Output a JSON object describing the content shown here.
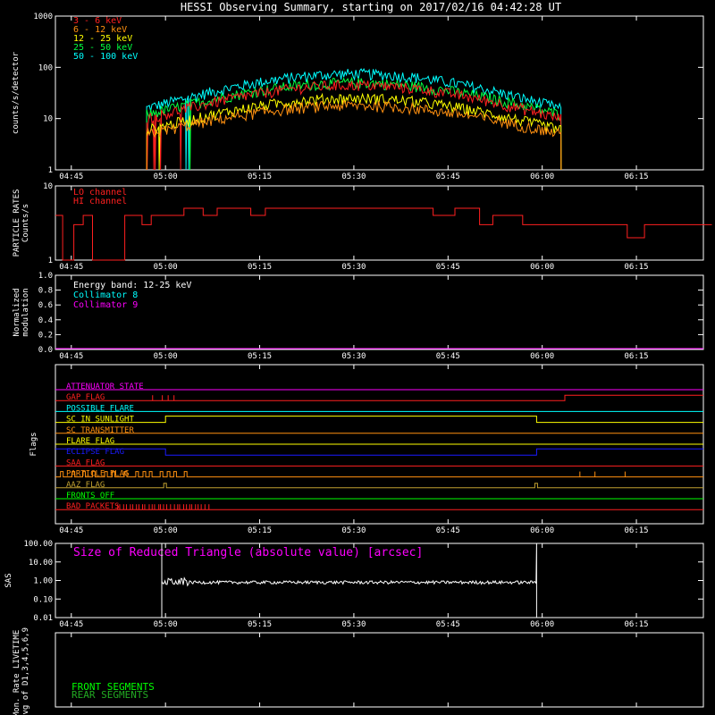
{
  "title": "HESSI Observing Summary, starting on 2017/02/16 04:42:28 UT",
  "time_ticks": [
    "04:45",
    "05:00",
    "05:15",
    "05:30",
    "05:45",
    "06:00",
    "06:15"
  ],
  "time_range_hours": [
    4.7078,
    6.4278
  ],
  "tick_hours": [
    4.75,
    5.0,
    5.25,
    5.5,
    5.75,
    6.0,
    6.25
  ],
  "colors": {
    "red": "#ff2020",
    "orange": "#ff9010",
    "yellow": "#ffff00",
    "green": "#00ff40",
    "cyan": "#00ffff",
    "magenta": "#ff00ff",
    "blue": "#1a1aff",
    "white": "#ffffff",
    "olive": "#c0a030",
    "lime": "#00ff00",
    "darkgreen": "#22aa22"
  },
  "chart_data": [
    {
      "type": "line",
      "panel": "count_rates",
      "ylabel": "counts/s/detector",
      "yscale": "log",
      "ylim": [
        1,
        1000
      ],
      "ytick_labels": [
        "1",
        "10",
        "100",
        "1000"
      ],
      "ytick_values": [
        1,
        10,
        100,
        1000
      ],
      "x_start_hours": 4.95,
      "x_end_hours": 6.05,
      "series": [
        {
          "name": "3 - 6 keV",
          "color": "#ff2020",
          "start": 10,
          "peak": 45
        },
        {
          "name": "6 - 12 keV",
          "color": "#ff9010",
          "start": 5,
          "peak": 18
        },
        {
          "name": "12 - 25 keV",
          "color": "#ffff00",
          "start": 6,
          "peak": 25
        },
        {
          "name": "25 - 50 keV",
          "color": "#00ff40",
          "start": 12,
          "peak": 50
        },
        {
          "name": "50 - 100 keV",
          "color": "#00ffff",
          "start": 16,
          "peak": 75
        }
      ]
    },
    {
      "type": "line",
      "panel": "particle_rates",
      "ylabel": "PARTICLE RATES\nCounts/s",
      "yscale": "log",
      "ylim": [
        1,
        10
      ],
      "ytick_labels": [
        "1",
        "10"
      ],
      "ytick_values": [
        1,
        10
      ],
      "series": [
        {
          "name": "LO channel",
          "color": "#ff2020"
        },
        {
          "name": "HI channel",
          "color": "#ff2020"
        }
      ]
    },
    {
      "type": "line",
      "panel": "modulation",
      "ylabel": "Normalized\nmodulation",
      "ylim": [
        0,
        1
      ],
      "ytick_labels": [
        "0.0",
        "0.2",
        "0.4",
        "0.6",
        "0.8",
        "1.0"
      ],
      "ytick_values": [
        0,
        0.2,
        0.4,
        0.6,
        0.8,
        1.0
      ],
      "annotation": "Energy band: 12-25 keV",
      "series": [
        {
          "name": "Collimator 8",
          "color": "#00ffff"
        },
        {
          "name": "Collimator 9",
          "color": "#ff00ff"
        }
      ]
    },
    {
      "type": "line",
      "panel": "flags",
      "ylabel": "Flags",
      "flags": [
        {
          "name": "ATTENUATOR STATE",
          "color": "#ff00ff"
        },
        {
          "name": "GAP FLAG",
          "color": "#ff2020"
        },
        {
          "name": "POSSIBLE FLARE",
          "color": "#00ffff"
        },
        {
          "name": "SC IN SUNLIGHT",
          "color": "#ffff00"
        },
        {
          "name": "SC TRANSMITTER",
          "color": "#ff9010"
        },
        {
          "name": "FLARE FLAG",
          "color": "#ffff00"
        },
        {
          "name": "ECLIPSE FLAG",
          "color": "#1a1aff"
        },
        {
          "name": "SAA FLAG",
          "color": "#ff2020"
        },
        {
          "name": "PARTICLE FLAG",
          "color": "#ff9010"
        },
        {
          "name": "AAZ FLAG",
          "color": "#c0a030"
        },
        {
          "name": "FRONTS OFF",
          "color": "#00ff00"
        },
        {
          "name": "BAD PACKETS",
          "color": "#ff2020"
        }
      ]
    },
    {
      "type": "line",
      "panel": "sas",
      "ylabel": "SAS",
      "yscale": "log",
      "ylim": [
        0.01,
        100
      ],
      "ytick_labels": [
        "0.01",
        "0.10",
        "1.00",
        "10.00",
        "100.00"
      ],
      "ytick_values": [
        0.01,
        0.1,
        1,
        10,
        100
      ],
      "annotation": "Size of Reduced Triangle (absolute value) [arcsec]",
      "series": [
        {
          "name": "Size of Reduced Triangle",
          "color": "#ffffff",
          "level": 0.8,
          "spike_start_hours": 4.99,
          "spike_end_hours": 5.985
        }
      ]
    },
    {
      "type": "line",
      "panel": "livetime",
      "ylabel": "Mon. Rate LIVETIME\navg of D1,3,4,5,6,9",
      "series": [
        {
          "name": "FRONT SEGMENTS",
          "color": "#00ff00"
        },
        {
          "name": "REAR SEGMENTS",
          "color": "#22aa22"
        }
      ]
    }
  ]
}
